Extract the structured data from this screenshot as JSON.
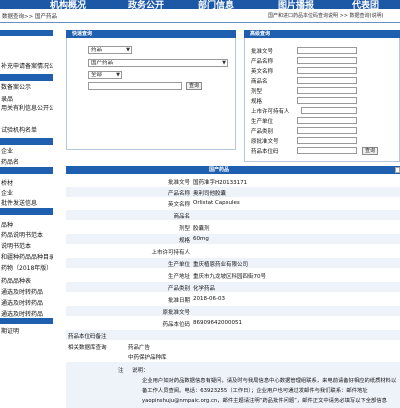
{
  "topnav": [
    "机构概况",
    "政务公开",
    "部门信息",
    "图片播报",
    "代表团"
  ],
  "breadcrumb": "数据查询>>  国产药品",
  "breadcrumb_right": "国产和进口药品本位码查询说明 >>    数据查询(说明)",
  "sidebar": [
    "补充申请备案情况公",
    "数备案公示",
    "录品",
    "用关有利信息公开公",
    "试验机构名单",
    "企业",
    "药品名",
    "桥材",
    "企业",
    "批件发送信息",
    "品种",
    "药品说明书范本",
    "说明书范本",
    "和疆种药品品种目录",
    "药物（2018年版）",
    "药品品种表",
    "通选及时转药品",
    "通选及时转药品",
    "通选及时转药品",
    "期证明"
  ],
  "quick_search": {
    "header": "快速查询",
    "category": "药品",
    "database": "国产药品",
    "scope": "全部",
    "query_value": "",
    "query_button": "查询"
  },
  "advanced_search": {
    "header": "高级查询",
    "fields": [
      "批准文号",
      "产品名称",
      "英文名称",
      "商品名",
      "剂型",
      "规格",
      "上市许可持有人",
      "生产单位",
      "产品类别",
      "原批准文号",
      "药品本位码"
    ],
    "query_button": "查询"
  },
  "result": {
    "header": "国产药品",
    "rows": [
      {
        "label": "批准文号",
        "value": "国药准字H20133171"
      },
      {
        "label": "产品名称",
        "value": "奥利司他胶囊"
      },
      {
        "label": "英文名称",
        "value": "Orlistat Capsules"
      },
      {
        "label": "商品名",
        "value": ""
      },
      {
        "label": "剂型",
        "value": "胶囊剂"
      },
      {
        "label": "规格",
        "value": "60mg"
      },
      {
        "label": "上市许可持有人",
        "value": ""
      },
      {
        "label": "生产单位",
        "value": "重庆植恩药业有限公司"
      },
      {
        "label": "生产地址",
        "value": "重庆市九龙坡区科园四街70号"
      },
      {
        "label": "产品类别",
        "value": "化学药品"
      },
      {
        "label": "批准日期",
        "value": "2018-06-03"
      },
      {
        "label": "原批准文号",
        "value": ""
      },
      {
        "label": "药品本位码",
        "value": "86909642000051"
      }
    ],
    "extra_rows": [
      {
        "label": "药品本位码备注",
        "value": ""
      },
      {
        "label": "相关数据库查询",
        "value": "药品广告"
      },
      {
        "label": "",
        "value": "中药保护品种库"
      }
    ],
    "note_label": "注",
    "note_title": "说明：",
    "note_text": "企业用户如对药品数据信息有疑问，请及时与我局信息中心数据管理组联系，来电前请备好相应的纸质材料以备工作人员查阅。电话：63923255（工作日）；企业用户也可通过发邮件与我们联系：邮件地址 yaopinshuju@nmpaic.org.cn，邮件主题请注明“药品批件问题”，邮件正文中请务必填写以下全部信息"
  }
}
